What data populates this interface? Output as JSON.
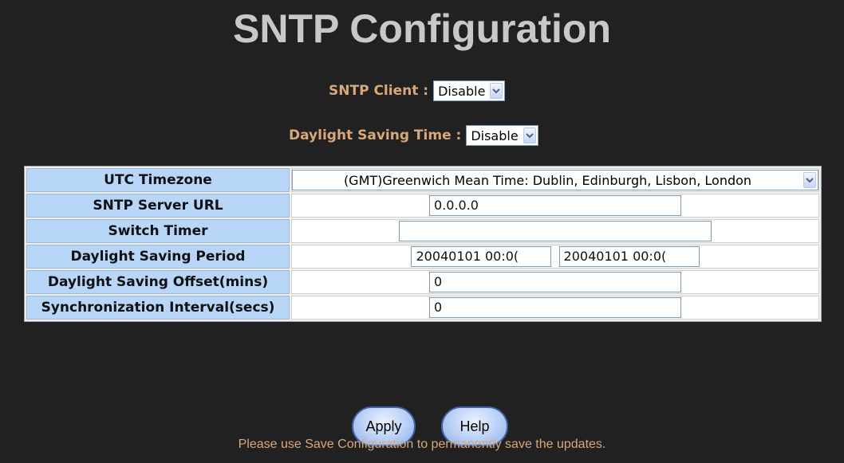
{
  "page": {
    "title": "SNTP Configuration",
    "note": "Please use Save Configuration to permanently save the updates."
  },
  "sntp_client": {
    "label": "SNTP Client :",
    "value": "Disable"
  },
  "dst": {
    "label": "Daylight Saving Time :",
    "value": "Disable"
  },
  "table": {
    "utc_timezone": {
      "label": "UTC Timezone",
      "value": "(GMT)Greenwich Mean Time: Dublin, Edinburgh, Lisbon, London"
    },
    "server_url": {
      "label": "SNTP Server URL",
      "value": "0.0.0.0"
    },
    "switch_timer": {
      "label": "Switch Timer",
      "value": ""
    },
    "dst_period": {
      "label": "Daylight Saving Period",
      "start": "20040101 00:0(",
      "end": "20040101 00:0("
    },
    "dst_offset": {
      "label": "Daylight Saving Offset(mins)",
      "value": "0"
    },
    "sync_interval": {
      "label": "Synchronization Interval(secs)",
      "value": "0"
    }
  },
  "buttons": {
    "apply": "Apply",
    "help": "Help"
  },
  "colors": {
    "background": "#212121",
    "accent_text": "#d8a878",
    "label_cell": "#b7d6f8"
  }
}
